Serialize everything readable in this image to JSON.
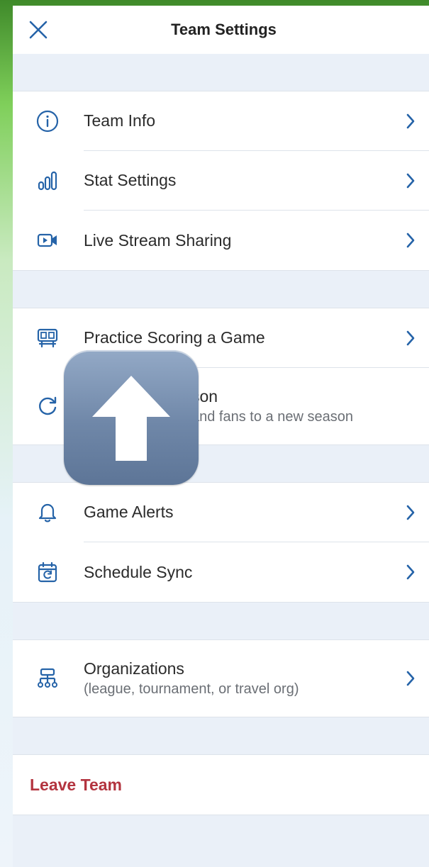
{
  "header": {
    "title": "Team Settings"
  },
  "groups": [
    {
      "items": [
        {
          "label": "Team Info",
          "icon": "info-icon"
        },
        {
          "label": "Stat Settings",
          "icon": "bar-chart-icon"
        },
        {
          "label": "Live Stream Sharing",
          "icon": "video-camera-icon"
        }
      ]
    },
    {
      "items": [
        {
          "label": "Practice Scoring a Game",
          "icon": "scoreboard-icon"
        },
        {
          "label": "son",
          "sublabel": "and fans to a new season",
          "icon": "refresh-icon"
        }
      ]
    },
    {
      "items": [
        {
          "label": "Game Alerts",
          "icon": "bell-icon"
        },
        {
          "label": "Schedule Sync",
          "icon": "calendar-sync-icon"
        }
      ]
    },
    {
      "items": [
        {
          "label": "Organizations",
          "sublabel": "(league, tournament, or travel org)",
          "icon": "org-chart-icon"
        }
      ]
    }
  ],
  "leave": {
    "label": "Leave Team"
  },
  "overlay": {
    "icon": "up-arrow-icon"
  },
  "colors": {
    "accent": "#2563a8",
    "danger": "#b3343f",
    "background": "#eaf0f8"
  }
}
